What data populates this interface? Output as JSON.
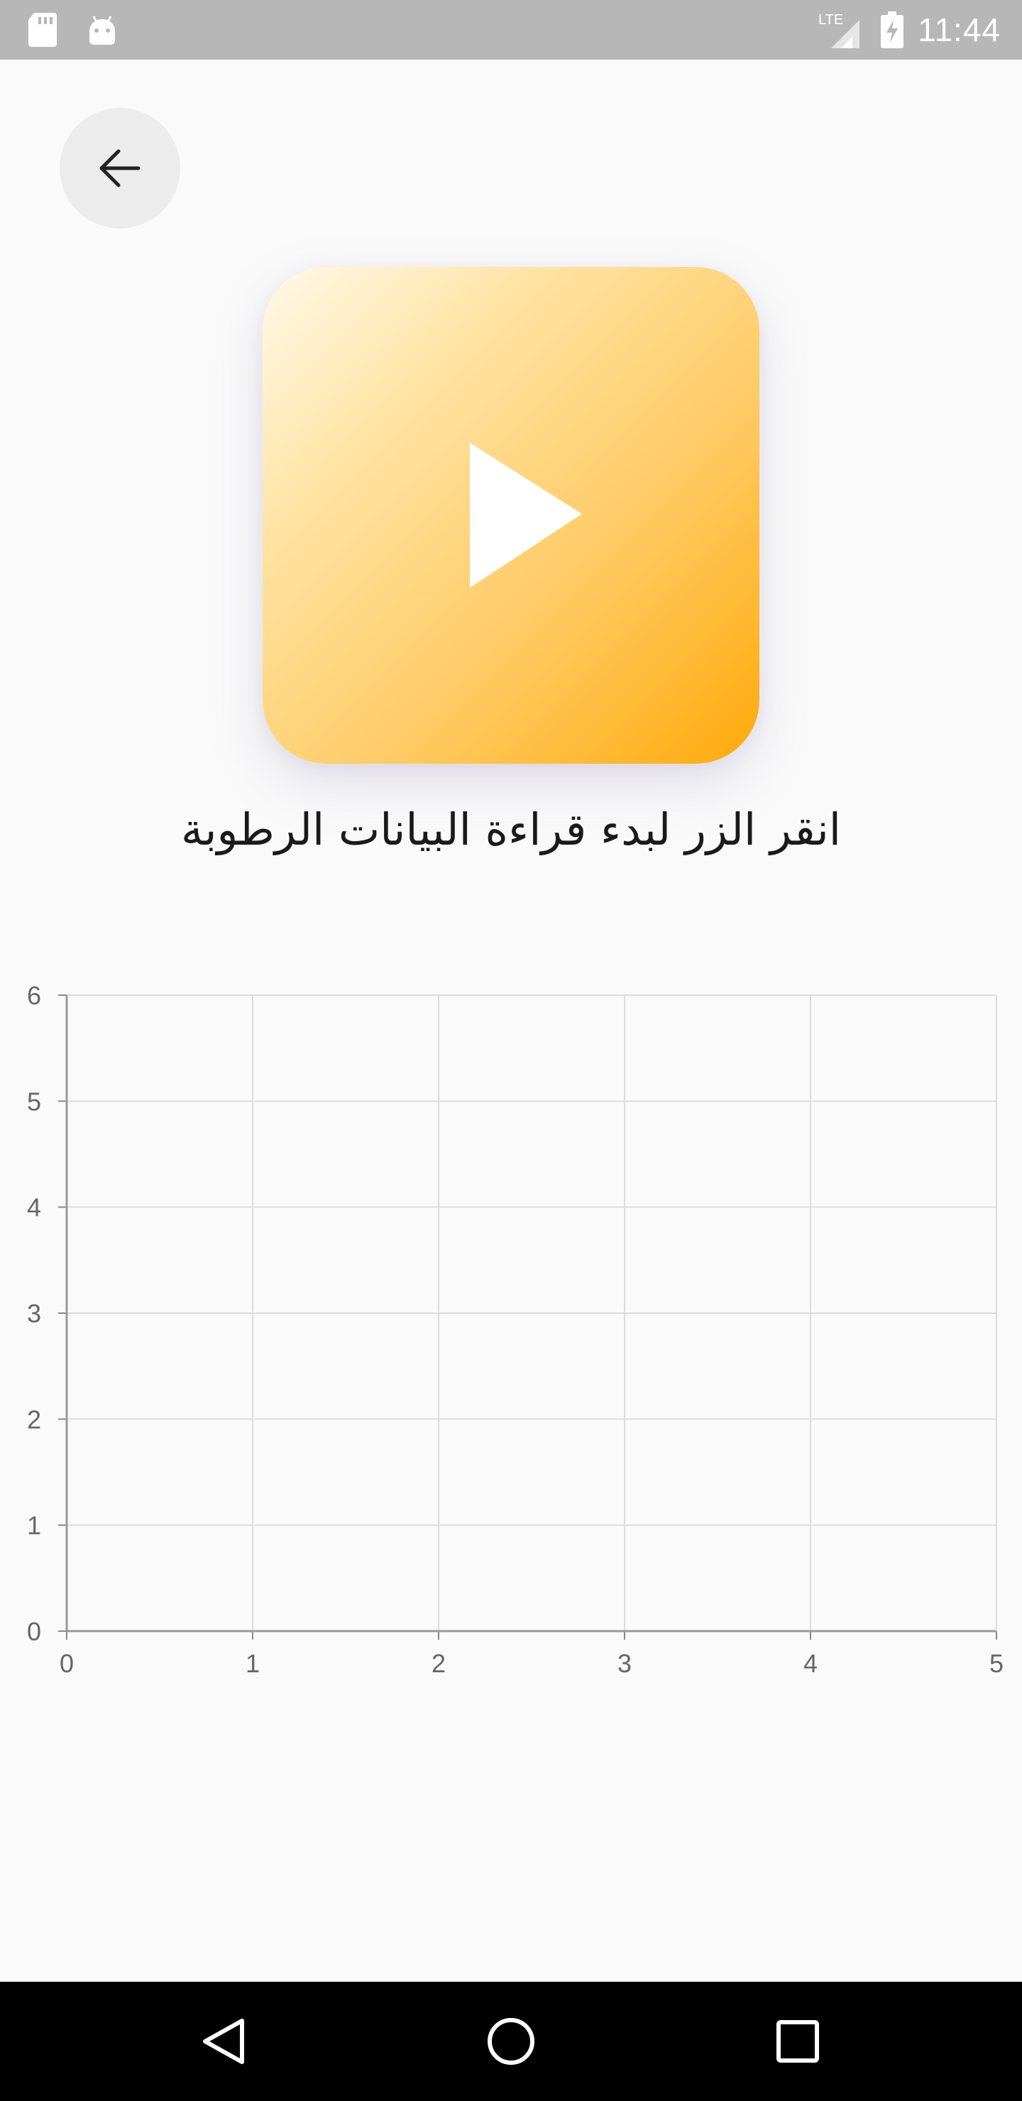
{
  "status_bar": {
    "time": "11:44",
    "network": "LTE",
    "icons": [
      "sd-card-icon",
      "android-icon",
      "signal-icon",
      "battery-charging-icon"
    ]
  },
  "back_button": {
    "icon": "arrow-left-icon"
  },
  "play_button": {
    "icon": "play-icon",
    "gradient": [
      "#fffaeb",
      "#ffcb66",
      "#ffaa0a"
    ]
  },
  "instruction_text": "انقر الزر لبدء قراءة البيانات الرطوبة",
  "chart_data": {
    "type": "line",
    "series": [],
    "x_ticks": [
      "0",
      "1",
      "2",
      "3",
      "4",
      "5"
    ],
    "y_ticks": [
      "0",
      "1",
      "2",
      "3",
      "4",
      "5",
      "6"
    ],
    "xlim": [
      0,
      5
    ],
    "ylim": [
      0,
      6
    ],
    "grid": true
  },
  "nav_bar": {
    "icons": [
      "back-triangle-icon",
      "home-circle-icon",
      "recents-square-icon"
    ]
  }
}
